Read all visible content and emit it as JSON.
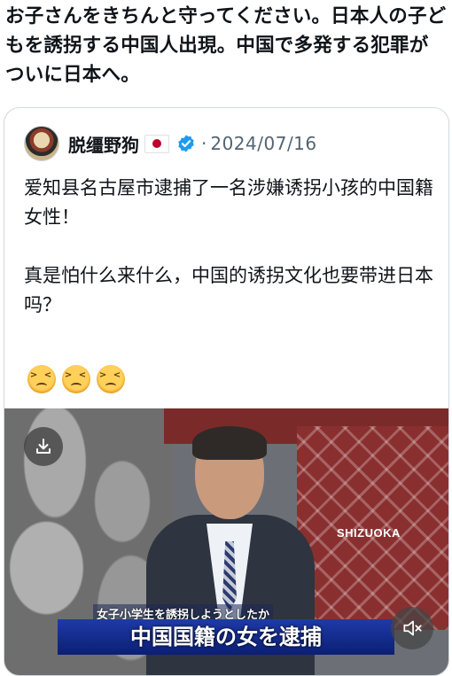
{
  "post": {
    "text": "お子さんをきちんと守ってください。日本人の子どもを誘拐する中国人出現。中国で多発する犯罪がついに日本へ。"
  },
  "quote": {
    "author_name": "脱缰野狗",
    "date": "2024/07/16",
    "body": "爱知县名古屋市逮捕了一名涉嫌诱拐小孩的中国籍女性！\n\n真是怕什么来什么，中国的诱拐文化也要带进日本吗？",
    "emojis": [
      "confounded-face",
      "confounded-face",
      "confounded-face"
    ]
  },
  "video": {
    "station_label": "SHIZUOKA",
    "caption_small": "女子小学生を誘拐しようとしたか",
    "caption_main": "中国国籍の女を逮捕"
  },
  "icons": {
    "verified": "verified-badge-icon",
    "download": "download-icon",
    "mute": "mute-icon"
  },
  "colors": {
    "verified_blue": "#1d9bf0",
    "secondary_text": "#536471",
    "card_border": "#cfd9de"
  }
}
